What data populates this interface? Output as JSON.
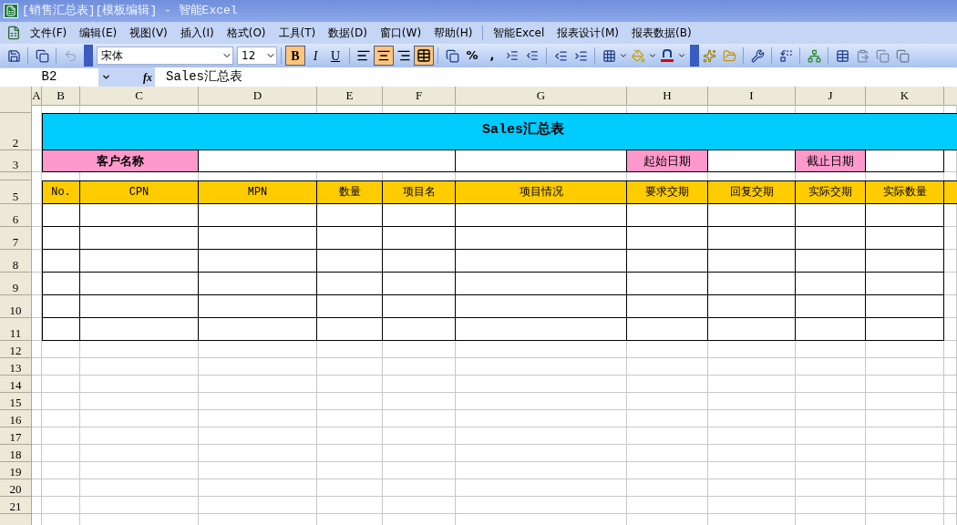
{
  "window": {
    "title": "[销售汇总表][模板编辑] - 智能Excel"
  },
  "menu": [
    {
      "label": "文件(F)"
    },
    {
      "label": "编辑(E)"
    },
    {
      "label": "视图(V)"
    },
    {
      "label": "插入(I)"
    },
    {
      "label": "格式(O)"
    },
    {
      "label": "工具(T)"
    },
    {
      "label": "数据(D)"
    },
    {
      "label": "窗口(W)"
    },
    {
      "label": "帮助(H)"
    },
    {
      "label": "智能Excel"
    },
    {
      "label": "报表设计(M)"
    },
    {
      "label": "报表数据(B)"
    }
  ],
  "toolbar": {
    "font": "宋体",
    "size": "12",
    "style_buttons": [
      {
        "label": "B",
        "selected": true
      },
      {
        "label": "I",
        "selected": false
      },
      {
        "label": "U",
        "selected": false
      }
    ],
    "align_buttons": [
      {
        "kind": "left",
        "selected": false
      },
      {
        "kind": "center",
        "selected": true
      },
      {
        "kind": "right",
        "selected": false
      },
      {
        "kind": "merge",
        "selected": true
      }
    ],
    "number_buttons": [
      "%",
      ","
    ]
  },
  "formula_bar": {
    "name_box": "B2",
    "fx": "fx",
    "value": "Sales汇总表"
  },
  "sheet": {
    "columns": [
      "A",
      "B",
      "C",
      "D",
      "E",
      "F",
      "G",
      "H",
      "I",
      "J",
      "K"
    ],
    "title": "Sales汇总表",
    "info": [
      {
        "kind": "label",
        "text": "客户名称"
      },
      {
        "kind": "field"
      },
      {
        "kind": "field"
      },
      {
        "kind": "label",
        "text": "起始日期"
      },
      {
        "kind": "field"
      },
      {
        "kind": "label",
        "text": "截止日期"
      },
      {
        "kind": "field"
      }
    ],
    "headers": [
      "No.",
      "CPN",
      "MPN",
      "数量",
      "项目名",
      "项目情况",
      "要求交期",
      "回复交期",
      "实际交期",
      "实际数量"
    ],
    "rows": [
      {
        "kind": "spacer"
      },
      {
        "label": "2",
        "kind": "title"
      },
      {
        "label": "3",
        "kind": "info"
      },
      {
        "kind": "spacer"
      },
      {
        "label": "5",
        "kind": "header"
      },
      {
        "label": "6",
        "kind": "data"
      },
      {
        "label": "7",
        "kind": "data"
      },
      {
        "label": "8",
        "kind": "data"
      },
      {
        "label": "9",
        "kind": "data"
      },
      {
        "label": "10",
        "kind": "data"
      },
      {
        "label": "11",
        "kind": "data"
      },
      {
        "label": "12",
        "kind": "empty"
      },
      {
        "label": "13",
        "kind": "empty"
      },
      {
        "label": "14",
        "kind": "empty"
      },
      {
        "label": "15",
        "kind": "empty"
      },
      {
        "label": "16",
        "kind": "empty"
      },
      {
        "label": "17",
        "kind": "empty"
      },
      {
        "label": "18",
        "kind": "empty"
      },
      {
        "label": "19",
        "kind": "empty"
      },
      {
        "label": "20",
        "kind": "empty"
      },
      {
        "label": "21",
        "kind": "empty"
      },
      {
        "kind": "empty"
      }
    ]
  }
}
